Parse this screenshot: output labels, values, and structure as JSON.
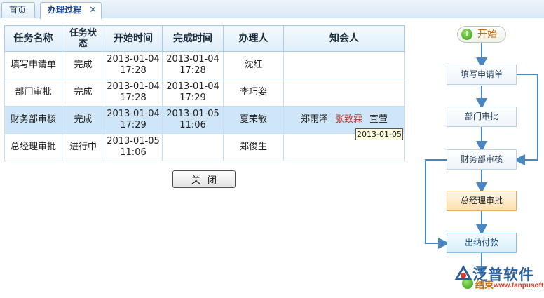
{
  "tabs": [
    {
      "label": "首页"
    },
    {
      "label": "办理过程",
      "close": "✕"
    }
  ],
  "table": {
    "headers": [
      "任务名称",
      "任务状态",
      "开始时间",
      "完成时间",
      "办理人",
      "知会人"
    ],
    "rows": [
      {
        "task": "填写申请单",
        "status": "完成",
        "start": "2013-01-04 17:28",
        "end": "2013-01-04 17:28",
        "handler": "沈红",
        "cc": []
      },
      {
        "task": "部门审批",
        "status": "完成",
        "start": "2013-01-04 17:28",
        "end": "2013-01-04 17:29",
        "handler": "李巧姿",
        "cc": []
      },
      {
        "task": "财务部审核",
        "status": "完成",
        "start": "2013-01-04 17:29",
        "end": "2013-01-05 11:06",
        "handler": "夏荣敏",
        "cc": [
          "郑雨泽",
          "张致霖",
          "宣萱"
        ]
      },
      {
        "task": "总经理审批",
        "status": "进行中",
        "start": "2013-01-05 11:06",
        "end": "",
        "handler": "郑俊生",
        "cc": []
      }
    ],
    "tooltip": "2013-01-05"
  },
  "close_button": "关闭",
  "flow": {
    "start": "开始",
    "nodes": [
      "填写申请单",
      "部门审批",
      "财务部审核",
      "总经理审批",
      "出纳付款"
    ],
    "current": "总经理审批",
    "end": "结束"
  },
  "watermark": {
    "name": "泛普软件",
    "url": "www.fanpusoft.com"
  },
  "colors": {
    "selected_row": "#cfe5f8",
    "current_node": "#fde0b0",
    "cc_highlight": "#c0392b",
    "start_text": "#c96a00"
  }
}
